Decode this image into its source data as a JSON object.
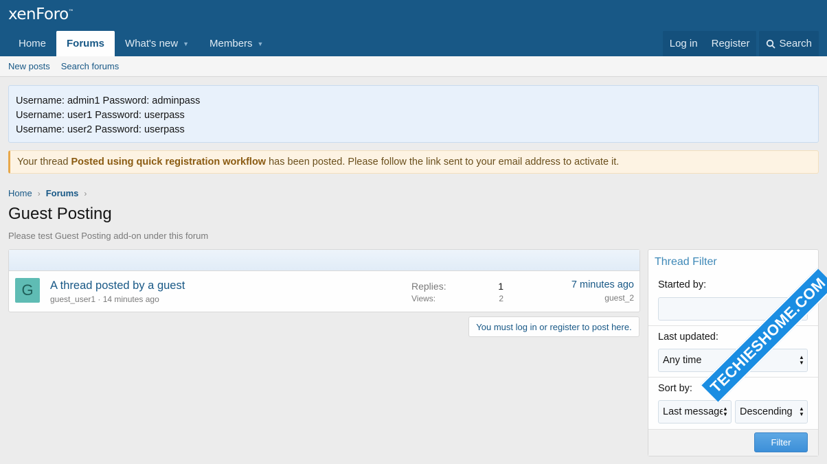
{
  "header": {
    "logo": "xenForo",
    "logo_mark": "™",
    "nav": [
      {
        "label": "Home"
      },
      {
        "label": "Forums"
      },
      {
        "label": "What's new"
      },
      {
        "label": "Members"
      }
    ],
    "login": "Log in",
    "register": "Register",
    "search": "Search"
  },
  "subnav": {
    "new_posts": "New posts",
    "search_forums": "Search forums"
  },
  "notice": {
    "lines": [
      "Username: admin1 Password: adminpass",
      "Username: user1 Password: userpass",
      "Username: user2 Password: userpass"
    ]
  },
  "alert": {
    "prefix": "Your thread",
    "thread_title": "Posted using quick registration workflow",
    "suffix": "has been posted. Please follow the link sent to your email address to activate it."
  },
  "breadcrumb": {
    "home": "Home",
    "forums": "Forums"
  },
  "page": {
    "title": "Guest Posting",
    "description": "Please test Guest Posting add-on under this forum"
  },
  "thread": {
    "avatar_letter": "G",
    "title": "A thread posted by a guest",
    "meta": "guest_user1 · 14 minutes ago",
    "replies_label": "Replies:",
    "replies": "1",
    "views_label": "Views:",
    "views": "2",
    "last_time": "7 minutes ago",
    "last_user": "guest_2"
  },
  "post_note": "You must log in or register to post here.",
  "filter": {
    "title": "Thread Filter",
    "started_by_label": "Started by:",
    "last_updated_label": "Last updated:",
    "last_updated_value": "Any time",
    "sort_by_label": "Sort by:",
    "sort_field": "Last message",
    "sort_order": "Descending",
    "button": "Filter"
  },
  "watermark": "TECHIESHOME.COM",
  "colors": {
    "header": "#185886",
    "link": "#185886",
    "alert_border": "#e8a84a",
    "filter_button": "#3c8fd8"
  }
}
